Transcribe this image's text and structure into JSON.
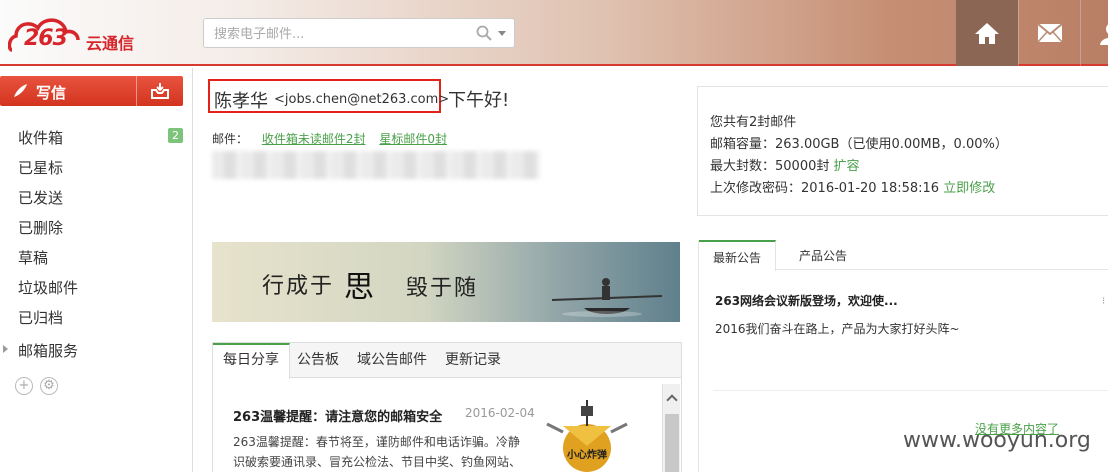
{
  "header": {
    "logo_text": "263",
    "logo_sub": "云通信",
    "search_placeholder": "搜索电子邮件..."
  },
  "sidebar": {
    "compose_label": "写信",
    "folders": [
      {
        "label": "收件箱",
        "badge": "2"
      },
      {
        "label": "已星标"
      },
      {
        "label": "已发送"
      },
      {
        "label": "已删除"
      },
      {
        "label": "草稿"
      },
      {
        "label": "垃圾邮件"
      },
      {
        "label": "已归档"
      }
    ],
    "services_label": "邮箱服务"
  },
  "greeting": {
    "name": "陈孝华",
    "email": "<jobs.chen@net263.com>",
    "hello": "下午好!",
    "mail_prefix": "邮件：",
    "unread_link": "收件箱未读邮件2封",
    "starred_link": "星标邮件0封"
  },
  "info": {
    "total": "您共有2封邮件",
    "capacity": "邮箱容量：263.00GB（已使用0.00MB，0.00%）",
    "max_count": "最大封数：50000封",
    "expand_link": "扩容",
    "last_pw": "上次修改密码：2016-01-20 18:58:16",
    "change_link": "立即修改"
  },
  "banner": {
    "part1": "行成于",
    "part2": "思",
    "part3": "毁于随"
  },
  "tabs": [
    "每日分享",
    "公告板",
    "域公告邮件",
    "更新记录"
  ],
  "article": {
    "title": "263温馨提醒：请注意您的邮箱安全",
    "date": "2016-02-04",
    "body": "263温馨提醒：春节将至，谨防邮件和电话诈骗。冷静识破索要通讯录、冒充公检法、节目中奖、钓鱼网站、",
    "image_label": "小心炸弹"
  },
  "announcements": {
    "tabs": [
      "最新公告",
      "产品公告"
    ],
    "title": "263网络会议新版登场，欢迎使...",
    "body": "2016我们奋斗在路上，产品为大家打好头阵~",
    "more": "没有更多内容了"
  },
  "watermark": "www.wooyun.org",
  "colors": {
    "accent_red": "#e2231a",
    "link_green": "#4aa04a"
  }
}
